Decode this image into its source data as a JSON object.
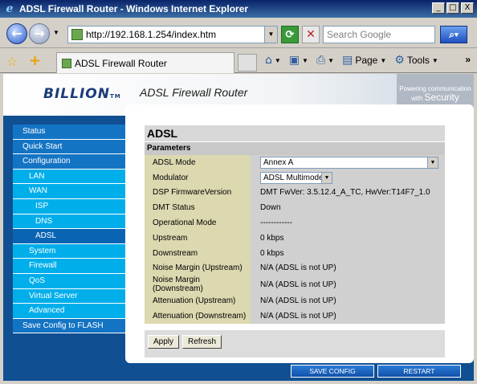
{
  "window": {
    "title": "ADSL Firewall Router - Windows Internet Explorer",
    "controls": [
      "_",
      "□",
      "X"
    ]
  },
  "browser": {
    "url": "http://192.168.1.254/index.htm",
    "search_placeholder": "Search Google",
    "tab_title": "ADSL Firewall Router",
    "commands": {
      "page": "Page",
      "tools": "Tools"
    }
  },
  "header": {
    "logo": "BILLION",
    "logo_tm": "TM",
    "title": "ADSL Firewall Router",
    "tagline_1": "Powering",
    "tagline_2": "communication",
    "tagline_3": "with",
    "tagline_4": "Security"
  },
  "sidebar": {
    "items": [
      {
        "label": "Status"
      },
      {
        "label": "Quick  Start"
      },
      {
        "label": "Configuration"
      },
      {
        "label": "LAN"
      },
      {
        "label": "WAN"
      },
      {
        "label": "ISP"
      },
      {
        "label": "DNS"
      },
      {
        "label": "ADSL"
      },
      {
        "label": "System"
      },
      {
        "label": "Firewall"
      },
      {
        "label": "QoS"
      },
      {
        "label": "Virtual  Server"
      },
      {
        "label": "Advanced"
      },
      {
        "label": "Save Config to FLASH"
      }
    ]
  },
  "panel": {
    "title": "ADSL",
    "subtitle": "Parameters",
    "rows": [
      {
        "label": "ADSL  Mode",
        "value": "Annex A"
      },
      {
        "label": "Modulator",
        "value": "ADSL Multimode"
      },
      {
        "label": "DSP  FirmwareVersion",
        "value": "DMT  FwVer:  3.5.12.4_A_TC,  HwVer:T14F7_1.0"
      },
      {
        "label": "DMT  Status",
        "value": "Down"
      },
      {
        "label": "Operational  Mode",
        "value": "------------"
      },
      {
        "label": "Upstream",
        "value": "0  kbps"
      },
      {
        "label": "Downstream",
        "value": "0  kbps"
      },
      {
        "label": "Noise  Margin  (Upstream)",
        "value": "N/A  (ADSL  is  not  UP)"
      },
      {
        "label": "Noise  Margin  (Downstream)",
        "value": "N/A  (ADSL  is  not  UP)"
      },
      {
        "label": "Attenuation  (Upstream)",
        "value": "N/A  (ADSL  is  not  UP)"
      },
      {
        "label": "Attenuation  (Downstream)",
        "value": "N/A  (ADSL  is  not  UP)"
      }
    ],
    "apply_label": "Apply",
    "refresh_label": "Refresh"
  },
  "footer": {
    "save_config": "SAVE CONFIG",
    "restart": "RESTART"
  }
}
